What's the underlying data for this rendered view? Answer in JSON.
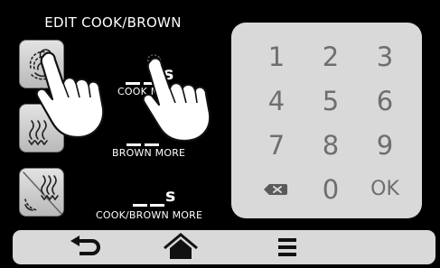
{
  "header": {
    "title": "EDIT COOK/BROWN"
  },
  "modes": [
    {
      "name": "cook-brown",
      "icon": "cook-brown-icon"
    },
    {
      "name": "brown-more",
      "icon": "brown-more-icon"
    },
    {
      "name": "cook-brown-more",
      "icon": "cook-brown-more-icon"
    }
  ],
  "settings": [
    {
      "value": "__s",
      "label": "COOK MORE"
    },
    {
      "value": "",
      "label": "BROWN MORE"
    },
    {
      "value": "__s",
      "label": "COOK/BROWN MORE"
    }
  ],
  "keypad": {
    "keys": [
      "1",
      "2",
      "3",
      "4",
      "5",
      "6",
      "7",
      "8",
      "9",
      "⌫",
      "0",
      "OK"
    ]
  },
  "nav": {
    "items": [
      {
        "icon": "back-arrow-icon"
      },
      {
        "icon": "home-icon"
      },
      {
        "icon": "menu-icon"
      }
    ]
  }
}
